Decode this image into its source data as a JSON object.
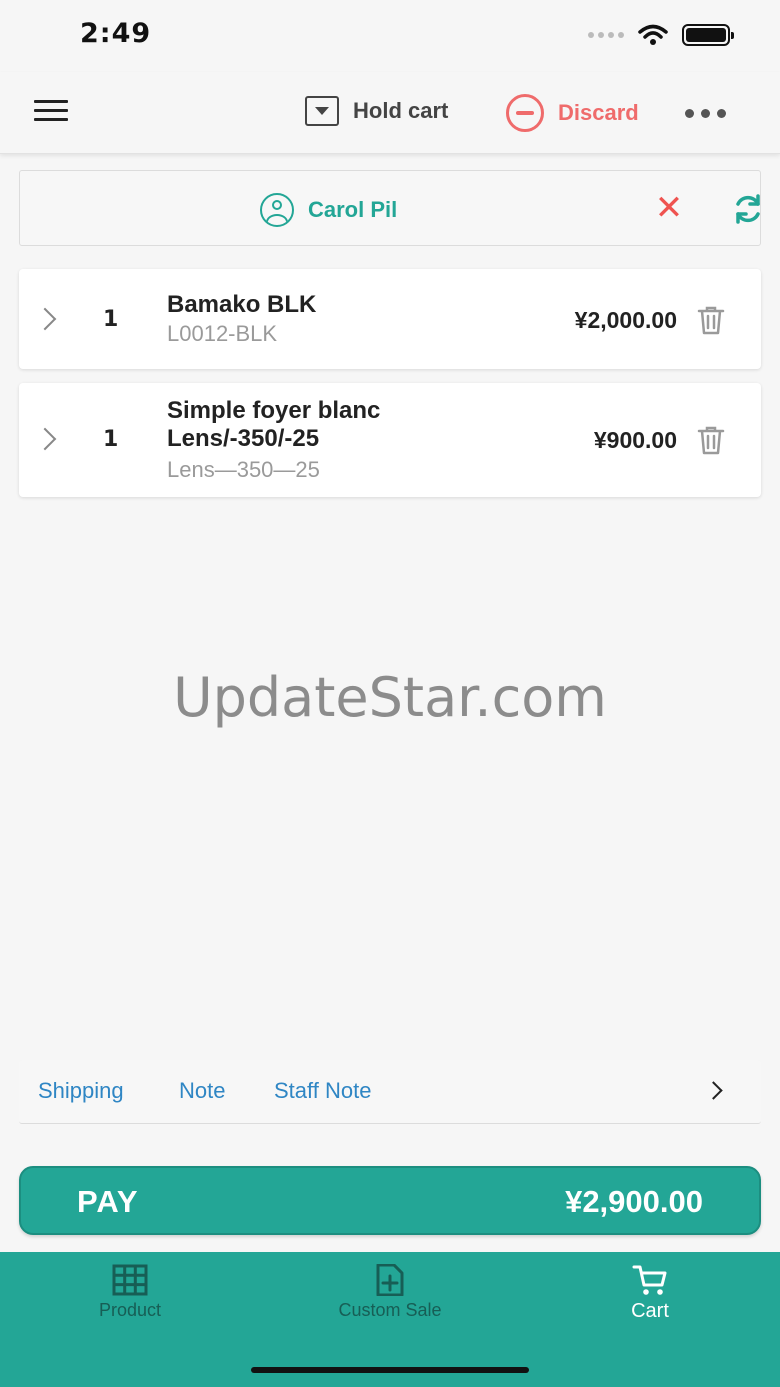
{
  "status_bar": {
    "time": "2:49"
  },
  "toolbar": {
    "hold_label": "Hold cart",
    "discard_label": "Discard",
    "discard_color": "#ef6b6b"
  },
  "customer": {
    "name": "Carol Pil"
  },
  "cart_items": [
    {
      "qty": "1",
      "name": "Bamako BLK",
      "sku": "L0012-BLK",
      "price": "¥2,000.00"
    },
    {
      "qty": "1",
      "name": "Simple foyer blanc Lens/-350/-25",
      "sku": "Lens—350—25",
      "price": "¥900.00"
    }
  ],
  "watermark": "UpdateStar.com",
  "notes": {
    "shipping": "Shipping",
    "note": "Note",
    "staff_note": "Staff Note"
  },
  "pay": {
    "label": "PAY",
    "amount": "¥2,900.00"
  },
  "bottom_nav": [
    {
      "label": "Product",
      "icon": "grid-icon"
    },
    {
      "label": "Custom Sale",
      "icon": "file-plus-icon"
    },
    {
      "label": "Cart",
      "icon": "cart-icon",
      "active": true
    }
  ],
  "colors": {
    "accent": "#23a696",
    "link": "#2f86c4",
    "danger": "#ef5350"
  }
}
